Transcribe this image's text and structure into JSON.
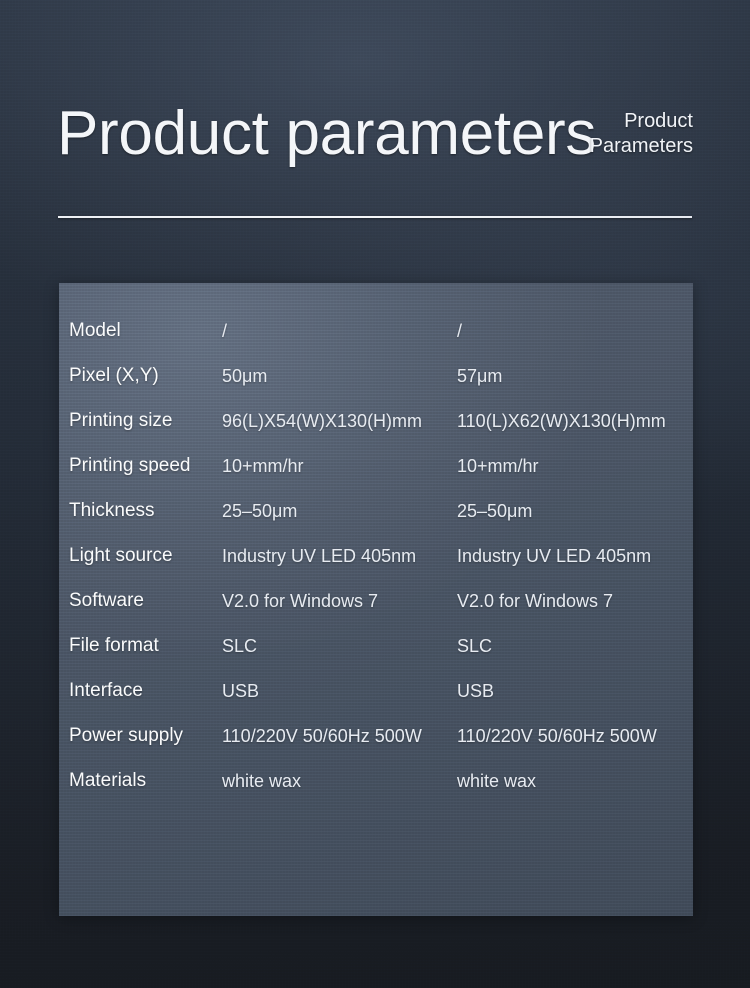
{
  "header": {
    "title": "Product parameters",
    "subtitle_line1": "Product",
    "subtitle_line2": "Parameters"
  },
  "colors": {
    "background_top": "#2c3644",
    "background_bottom": "#191d24",
    "panel": "#4b5667",
    "label_text": "#fbfcfd",
    "value_text": "#e8ecf2",
    "divider": "#f4f6f9"
  },
  "spec_table": {
    "rows": [
      {
        "label": "Model",
        "value_a": "/",
        "value_b": "/"
      },
      {
        "label": "Pixel (X,Y)",
        "value_a": "50μm",
        "value_b": "57μm"
      },
      {
        "label": "Printing size",
        "value_a": "96(L)X54(W)X130(H)mm",
        "value_b": "110(L)X62(W)X130(H)mm"
      },
      {
        "label": "Printing speed",
        "value_a": "10+mm/hr",
        "value_b": "10+mm/hr"
      },
      {
        "label": "Thickness",
        "value_a": "25–50μm",
        "value_b": "25–50μm"
      },
      {
        "label": "Light source",
        "value_a": "Industry UV LED 405nm",
        "value_b": "Industry UV LED 405nm"
      },
      {
        "label": "Software",
        "value_a": "V2.0 for Windows 7",
        "value_b": "V2.0 for Windows 7"
      },
      {
        "label": "File format",
        "value_a": "SLC",
        "value_b": "SLC"
      },
      {
        "label": "Interface",
        "value_a": "USB",
        "value_b": "USB"
      },
      {
        "label": "Power supply",
        "value_a": "110/220V 50/60Hz 500W",
        "value_b": "110/220V 50/60Hz 500W"
      },
      {
        "label": "Materials",
        "value_a": "white wax",
        "value_b": "white wax"
      }
    ]
  }
}
